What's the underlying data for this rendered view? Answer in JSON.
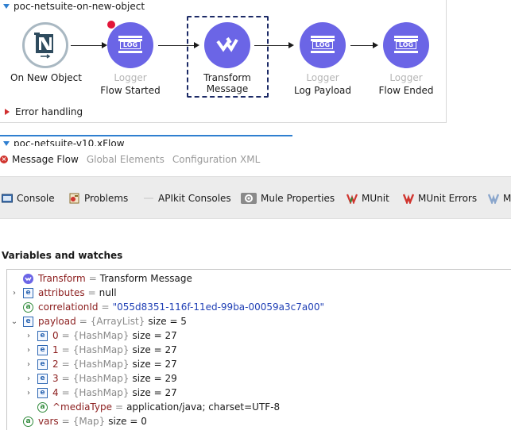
{
  "flow": {
    "title": "poc-netsuite-on-new-object",
    "nodes": {
      "source": {
        "label": "On New Object"
      },
      "logger1": {
        "sub": "Logger",
        "label": "Flow Started"
      },
      "transform": {
        "label_line1": "Transform",
        "label_line2": "Message"
      },
      "logger2": {
        "sub": "Logger",
        "label": "Log Payload"
      },
      "logger3": {
        "sub": "Logger",
        "label": "Flow Ended"
      }
    },
    "log_text": "LOG",
    "error_handling": "Error handling",
    "second_flow_title": "poc-netsuite-v10.xFlow"
  },
  "editor_tabs": {
    "message_flow": "Message Flow",
    "global_elements": "Global Elements",
    "configuration_xml": "Configuration XML"
  },
  "views": {
    "console": "Console",
    "problems": "Problems",
    "apikit": "APIkit Consoles",
    "mule_properties": "Mule Properties",
    "munit": "MUnit",
    "munit_errors": "MUnit Errors",
    "overflow": "M"
  },
  "variables": {
    "title": "Variables and watches",
    "rows": [
      {
        "name": "Transform",
        "eq": "=",
        "value": "Transform Message"
      },
      {
        "name": "attributes",
        "eq": "=",
        "value": "null"
      },
      {
        "name": "correlationId",
        "eq": "=",
        "value": "\"055d8351-116f-11ed-99ba-00059a3c7a00\""
      },
      {
        "name": "payload",
        "eq": "=",
        "type": "{ArrayList}",
        "value": "size = 5"
      },
      {
        "name": "0",
        "eq": "=",
        "type": "{HashMap}",
        "value": "size = 27"
      },
      {
        "name": "1",
        "eq": "=",
        "type": "{HashMap}",
        "value": "size = 27"
      },
      {
        "name": "2",
        "eq": "=",
        "type": "{HashMap}",
        "value": "size = 27"
      },
      {
        "name": "3",
        "eq": "=",
        "type": "{HashMap}",
        "value": "size = 29"
      },
      {
        "name": "4",
        "eq": "=",
        "type": "{HashMap}",
        "value": "size = 27"
      },
      {
        "name": "^mediaType",
        "eq": "=",
        "value": "application/java; charset=UTF-8"
      },
      {
        "name": "vars",
        "eq": "=",
        "type": "{Map}",
        "value": "size = 0"
      }
    ]
  },
  "colors": {
    "node_purple": "#6b65e6",
    "var_name": "#8b1d1d",
    "string_value": "#1f3fb5",
    "selection": "#1c2a66"
  }
}
